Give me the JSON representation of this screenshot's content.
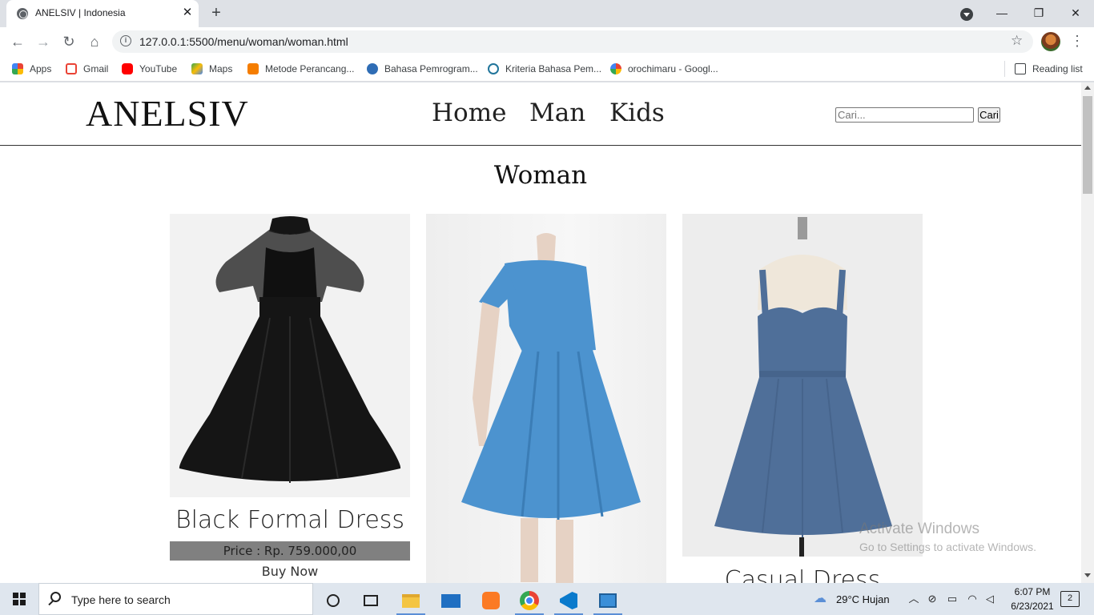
{
  "browser": {
    "tab_title": "ANELSIV | Indonesia",
    "url": "127.0.0.1:5500/menu/woman/woman.html",
    "bookmarks": [
      "Apps",
      "Gmail",
      "YouTube",
      "Maps",
      "Metode Perancang...",
      "Bahasa Pemrogram...",
      "Kriteria Bahasa Pem...",
      "orochimaru - Googl..."
    ],
    "reading_list": "Reading list"
  },
  "site": {
    "logo": "ANELSIV",
    "nav": [
      "Home",
      "Man",
      "Kids"
    ],
    "search_placeholder": "Cari...",
    "search_button": "Cari",
    "section_title": "Woman",
    "products": [
      {
        "name": "Black Formal Dress",
        "price": "Price : Rp. 759.000,00",
        "cta": "Buy Now"
      },
      {
        "name": "Casual Dress"
      }
    ]
  },
  "watermark": {
    "line1": "Activate Windows",
    "line2": "Go to Settings to activate Windows."
  },
  "taskbar": {
    "search_text": "Type here to search",
    "weather": "29°C  Hujan",
    "time": "6:07 PM",
    "date": "6/23/2021",
    "notifications": "2"
  },
  "colors": {
    "price_bar": "#808080",
    "dress_black": "#151515",
    "dress_blue": "#4c93cf",
    "dress_denim": "#4f6f99"
  }
}
